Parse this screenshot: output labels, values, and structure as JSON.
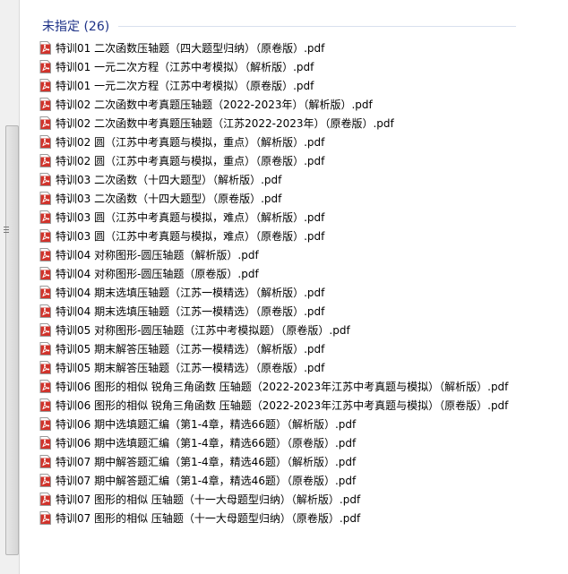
{
  "group": {
    "title": "未指定 (26)"
  },
  "colors": {
    "group_title": "#1e3287",
    "pdf_icon": "#d0332b"
  },
  "files": [
    {
      "name": "特训01 二次函数压轴题（四大题型归纳）（原卷版）.pdf",
      "icon": "pdf-icon"
    },
    {
      "name": "特训01 一元二次方程（江苏中考模拟）（解析版）.pdf",
      "icon": "pdf-icon"
    },
    {
      "name": "特训01 一元二次方程（江苏中考模拟）（原卷版）.pdf",
      "icon": "pdf-icon"
    },
    {
      "name": "特训02 二次函数中考真题压轴题（2022-2023年）（解析版）.pdf",
      "icon": "pdf-icon"
    },
    {
      "name": "特训02 二次函数中考真题压轴题（江苏2022-2023年）（原卷版）.pdf",
      "icon": "pdf-icon"
    },
    {
      "name": "特训02 圆（江苏中考真题与模拟，重点）（解析版）.pdf",
      "icon": "pdf-icon"
    },
    {
      "name": "特训02 圆（江苏中考真题与模拟，重点）（原卷版）.pdf",
      "icon": "pdf-icon"
    },
    {
      "name": "特训03  二次函数（十四大题型）（解析版）.pdf",
      "icon": "pdf-icon"
    },
    {
      "name": "特训03 二次函数（十四大题型）（原卷版）.pdf",
      "icon": "pdf-icon"
    },
    {
      "name": "特训03 圆（江苏中考真题与模拟，难点）（解析版）.pdf",
      "icon": "pdf-icon"
    },
    {
      "name": "特训03 圆（江苏中考真题与模拟，难点）（原卷版）.pdf",
      "icon": "pdf-icon"
    },
    {
      "name": "特训04 对称图形-圆压轴题（解析版）.pdf",
      "icon": "pdf-icon"
    },
    {
      "name": "特训04 对称图形-圆压轴题（原卷版）.pdf",
      "icon": "pdf-icon"
    },
    {
      "name": "特训04 期末选填压轴题（江苏一模精选）（解析版）.pdf",
      "icon": "pdf-icon"
    },
    {
      "name": "特训04 期末选填压轴题（江苏一模精选）（原卷版）.pdf",
      "icon": "pdf-icon"
    },
    {
      "name": "特训05 对称图形-圆压轴题（江苏中考模拟题）（原卷版）.pdf",
      "icon": "pdf-icon"
    },
    {
      "name": "特训05 期末解答压轴题（江苏一模精选）（解析版）.pdf",
      "icon": "pdf-icon"
    },
    {
      "name": "特训05 期末解答压轴题（江苏一模精选）（原卷版）.pdf",
      "icon": "pdf-icon"
    },
    {
      "name": "特训06  图形的相似 锐角三角函数 压轴题（2022-2023年江苏中考真题与模拟）（解析版）.pdf",
      "icon": "pdf-icon"
    },
    {
      "name": "特训06  图形的相似 锐角三角函数 压轴题（2022-2023年江苏中考真题与模拟）（原卷版）.pdf",
      "icon": "pdf-icon"
    },
    {
      "name": "特训06 期中选填题汇编（第1-4章，精选66题）（解析版）.pdf",
      "icon": "pdf-icon"
    },
    {
      "name": "特训06 期中选填题汇编（第1-4章，精选66题）（原卷版）.pdf",
      "icon": "pdf-icon"
    },
    {
      "name": "特训07 期中解答题汇编（第1-4章，精选46题）（解析版）.pdf",
      "icon": "pdf-icon"
    },
    {
      "name": "特训07 期中解答题汇编（第1-4章，精选46题）（原卷版）.pdf",
      "icon": "pdf-icon"
    },
    {
      "name": "特训07 图形的相似 压轴题（十一大母题型归纳）（解析版）.pdf",
      "icon": "pdf-icon"
    },
    {
      "name": "特训07 图形的相似 压轴题（十一大母题型归纳）（原卷版）.pdf",
      "icon": "pdf-icon"
    }
  ]
}
